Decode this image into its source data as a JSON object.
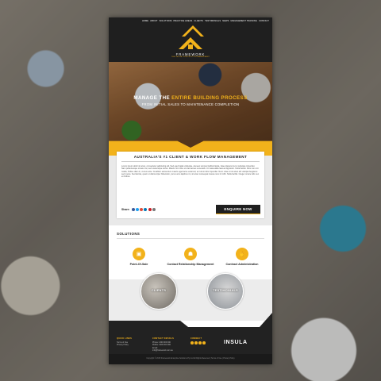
{
  "header": {
    "nav": [
      "Home",
      "About",
      "Solutions",
      "Practice Areas",
      "Clients",
      "Testimonials",
      "News",
      "Management Training",
      "Contact"
    ],
    "logo_name": "FRAMEWORK",
    "logo_tagline": "THE ONLINE CONSTRUCTION MANAGEMENT"
  },
  "hero": {
    "title_a": "MANAGE THE",
    "title_highlight": "ENTIRE BUILDING PROCESS",
    "subtitle": "FROM INITIAL SALES TO MAINTENANCE COMPLETION"
  },
  "intro": {
    "title": "AUSTRALIA'S #1 CLIENT & WORK FLOW MANAGEMENT",
    "body": "Lorem ipsum dolor sit amet, consectetur adipiscing elit. Sed eget fugiat vulputate. Aenean tempus facilisis ligula, vitae placerat nunc vulputate imperdiet. Nam pellentesque ornare nisi, sed scelerisque lectus. Mauris non risus ut erat laoreet venenatis. Ut malesuada laoreet dignissim. Nulla facilisi. Duis non orci mattis, finibus diam in, cursus ante. Curabitur elementum mauris eget lacus euismod, et rutrum felis imperdiet. Nunc vitae mi sit amet elit volutpat feugiat et sed metus. Sed lacinia, quam ut ullamcorper bibendum, purus arcu dapibus mi, sit amet consequat massa nunc id nibh. Nulla facilisi. Integer ornare felis nec ex finibus.",
    "share_label": "Share:",
    "share_colors": [
      "#3b5998",
      "#1da1f2",
      "#dd4b39",
      "#0077b5",
      "#cb2027",
      "#777777"
    ],
    "enquire_label": "ENQUIRE NOW"
  },
  "solutions": {
    "title": "SOLUTIONS",
    "items": [
      {
        "label": "Point-Of-Sale",
        "icon": "pos-icon"
      },
      {
        "label": "Contact Relationship Management",
        "icon": "people-icon"
      },
      {
        "label": "Contract Administration",
        "icon": "handshake-icon"
      }
    ]
  },
  "bubbles": {
    "clients": "CLIENTS",
    "testimonials": "TESTIMONIALS"
  },
  "footer": {
    "quick_links_heading": "QUICK LINKS",
    "quick_links": [
      "Terms of Use",
      "Privacy Policy"
    ],
    "contact_heading": "CONTACT DETAILS",
    "contact_lines": [
      "Phone: 1300 000 000",
      "Mobile: 0400 000 000",
      "",
      "Email:",
      "info@framework.com.au"
    ],
    "connect_heading": "CONNECT",
    "brand": "INSULA",
    "copyright": "Copyright © 2015 Framework Enterprise Solutions Pty Ltd All Rights Reserved  |  Terms of Use  |  Privacy Policy"
  },
  "colors": {
    "accent": "#f2b21b",
    "dark": "#1f1f1f"
  }
}
